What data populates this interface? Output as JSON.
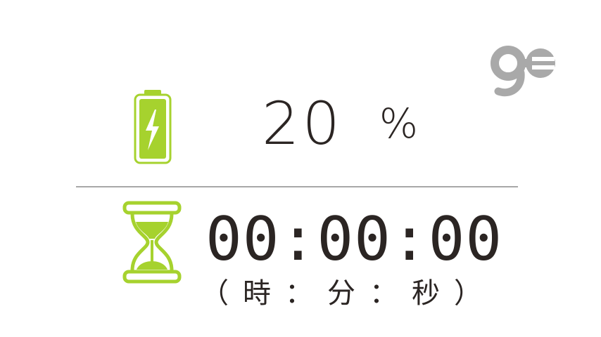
{
  "colors": {
    "accent_green": "#a6d22e",
    "icon_gray": "#a9a9a9",
    "text": "#2b2523",
    "divider": "#a8a8a8"
  },
  "icons": {
    "plug": "plug-icon",
    "battery": "battery-charging-icon",
    "hourglass": "hourglass-icon"
  },
  "battery": {
    "value": "20",
    "unit": "%"
  },
  "timer": {
    "value": "00:00:00",
    "units": [
      "（",
      "時",
      "：",
      "分",
      "：",
      "秒",
      "）"
    ]
  }
}
